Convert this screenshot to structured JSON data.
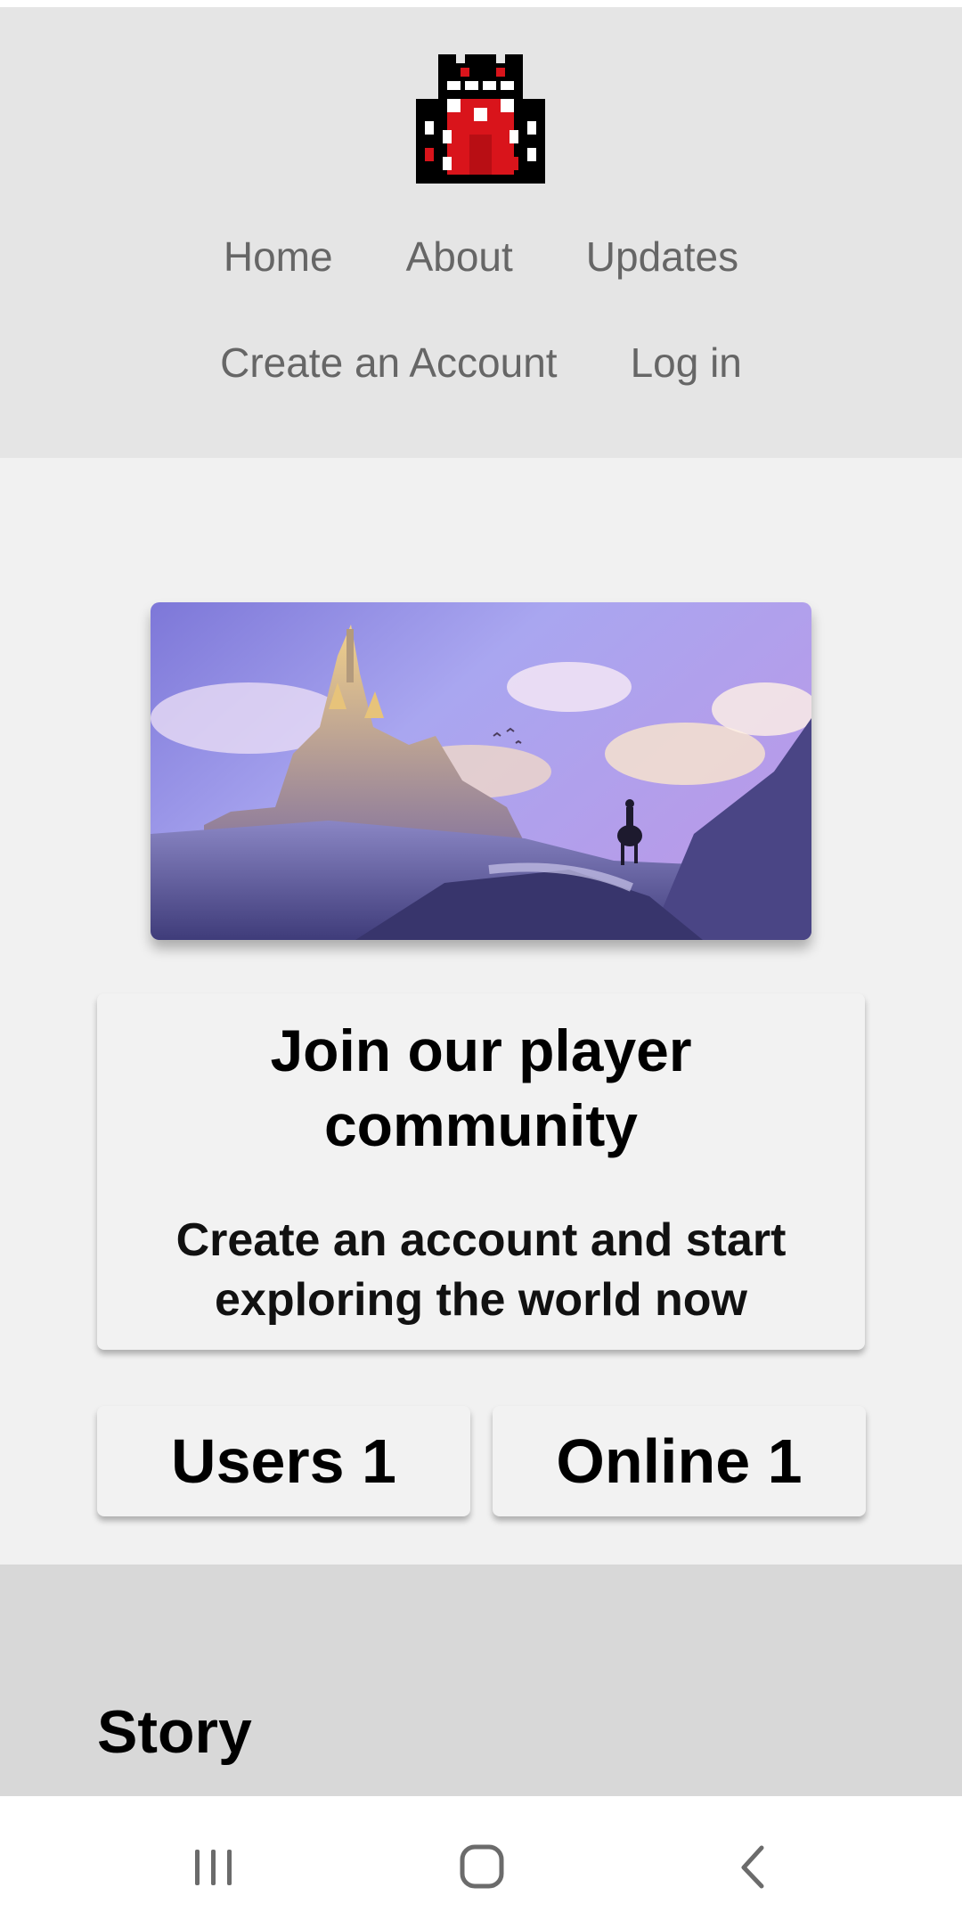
{
  "header": {
    "logo": "castle-logo",
    "nav_row1": [
      "Home",
      "About",
      "Updates"
    ],
    "nav_row2": [
      "Create an Account",
      "Log in"
    ]
  },
  "hero": {
    "image": "castle-landscape-with-rider-illustration"
  },
  "join_card": {
    "title": "Join our player community",
    "subtitle": "Create an account and start exploring the world now"
  },
  "stats": {
    "users": "Users 1",
    "online": "Online 1"
  },
  "story": {
    "title": "Story"
  },
  "system_nav": {
    "icons": [
      "recent-apps-icon",
      "home-icon",
      "back-icon"
    ]
  },
  "colors": {
    "header_bg": "#e5e5e5",
    "page_bg": "#f1f1f1",
    "story_bg": "#d8d8d8",
    "logo_red": "#d9141b",
    "nav_text": "#666666"
  }
}
